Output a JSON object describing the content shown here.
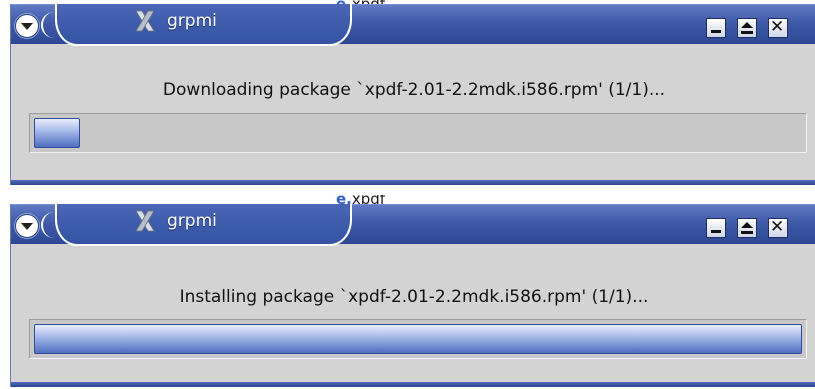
{
  "background_peek": {
    "accent": "e.",
    "text": "xpdf"
  },
  "windows": [
    {
      "title": "grpmi",
      "status_text": "Downloading package `xpdf-2.01-2.2mdk.i586.rpm' (1/1)...",
      "progress": 0.06
    },
    {
      "title": "grpmi",
      "status_text": "Installing package `xpdf-2.01-2.2mdk.i586.rpm' (1/1)...",
      "progress": 1.0
    }
  ],
  "buttons": {
    "close_glyph": "✕"
  },
  "colors": {
    "titlebar": "#3f5aa8",
    "window_bg": "#d3d3d3",
    "progress_fill": "#4f6fc0"
  }
}
